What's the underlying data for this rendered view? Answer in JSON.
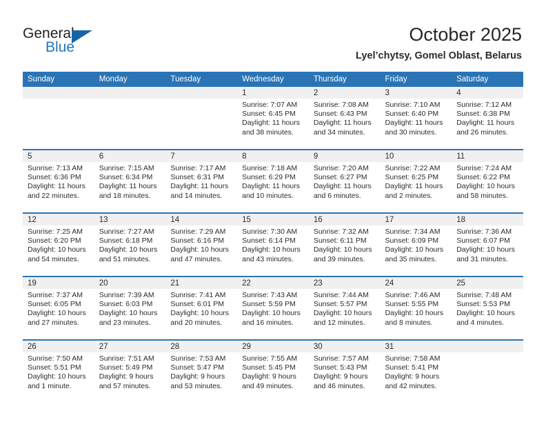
{
  "brand": {
    "name_top": "General",
    "name_bottom": "Blue",
    "accent_color": "#1e76bd",
    "triangle_color": "#1565a6"
  },
  "header": {
    "title": "October 2025",
    "subtitle": "Lyel’chytsy, Gomel Oblast, Belarus"
  },
  "theme": {
    "header_bg": "#2a74b6",
    "daynum_bg": "#f0f0f0",
    "cell_bg": "#ffffff",
    "text": "#2b2b2b"
  },
  "weekday_headers": [
    "Sunday",
    "Monday",
    "Tuesday",
    "Wednesday",
    "Thursday",
    "Friday",
    "Saturday"
  ],
  "weeks": [
    [
      {
        "day": "",
        "sunrise": "",
        "sunset": "",
        "daylight_1": "",
        "daylight_2": ""
      },
      {
        "day": "",
        "sunrise": "",
        "sunset": "",
        "daylight_1": "",
        "daylight_2": ""
      },
      {
        "day": "",
        "sunrise": "",
        "sunset": "",
        "daylight_1": "",
        "daylight_2": ""
      },
      {
        "day": "1",
        "sunrise": "Sunrise: 7:07 AM",
        "sunset": "Sunset: 6:45 PM",
        "daylight_1": "Daylight: 11 hours",
        "daylight_2": "and 38 minutes."
      },
      {
        "day": "2",
        "sunrise": "Sunrise: 7:08 AM",
        "sunset": "Sunset: 6:43 PM",
        "daylight_1": "Daylight: 11 hours",
        "daylight_2": "and 34 minutes."
      },
      {
        "day": "3",
        "sunrise": "Sunrise: 7:10 AM",
        "sunset": "Sunset: 6:40 PM",
        "daylight_1": "Daylight: 11 hours",
        "daylight_2": "and 30 minutes."
      },
      {
        "day": "4",
        "sunrise": "Sunrise: 7:12 AM",
        "sunset": "Sunset: 6:38 PM",
        "daylight_1": "Daylight: 11 hours",
        "daylight_2": "and 26 minutes."
      }
    ],
    [
      {
        "day": "5",
        "sunrise": "Sunrise: 7:13 AM",
        "sunset": "Sunset: 6:36 PM",
        "daylight_1": "Daylight: 11 hours",
        "daylight_2": "and 22 minutes."
      },
      {
        "day": "6",
        "sunrise": "Sunrise: 7:15 AM",
        "sunset": "Sunset: 6:34 PM",
        "daylight_1": "Daylight: 11 hours",
        "daylight_2": "and 18 minutes."
      },
      {
        "day": "7",
        "sunrise": "Sunrise: 7:17 AM",
        "sunset": "Sunset: 6:31 PM",
        "daylight_1": "Daylight: 11 hours",
        "daylight_2": "and 14 minutes."
      },
      {
        "day": "8",
        "sunrise": "Sunrise: 7:18 AM",
        "sunset": "Sunset: 6:29 PM",
        "daylight_1": "Daylight: 11 hours",
        "daylight_2": "and 10 minutes."
      },
      {
        "day": "9",
        "sunrise": "Sunrise: 7:20 AM",
        "sunset": "Sunset: 6:27 PM",
        "daylight_1": "Daylight: 11 hours",
        "daylight_2": "and 6 minutes."
      },
      {
        "day": "10",
        "sunrise": "Sunrise: 7:22 AM",
        "sunset": "Sunset: 6:25 PM",
        "daylight_1": "Daylight: 11 hours",
        "daylight_2": "and 2 minutes."
      },
      {
        "day": "11",
        "sunrise": "Sunrise: 7:24 AM",
        "sunset": "Sunset: 6:22 PM",
        "daylight_1": "Daylight: 10 hours",
        "daylight_2": "and 58 minutes."
      }
    ],
    [
      {
        "day": "12",
        "sunrise": "Sunrise: 7:25 AM",
        "sunset": "Sunset: 6:20 PM",
        "daylight_1": "Daylight: 10 hours",
        "daylight_2": "and 54 minutes."
      },
      {
        "day": "13",
        "sunrise": "Sunrise: 7:27 AM",
        "sunset": "Sunset: 6:18 PM",
        "daylight_1": "Daylight: 10 hours",
        "daylight_2": "and 51 minutes."
      },
      {
        "day": "14",
        "sunrise": "Sunrise: 7:29 AM",
        "sunset": "Sunset: 6:16 PM",
        "daylight_1": "Daylight: 10 hours",
        "daylight_2": "and 47 minutes."
      },
      {
        "day": "15",
        "sunrise": "Sunrise: 7:30 AM",
        "sunset": "Sunset: 6:14 PM",
        "daylight_1": "Daylight: 10 hours",
        "daylight_2": "and 43 minutes."
      },
      {
        "day": "16",
        "sunrise": "Sunrise: 7:32 AM",
        "sunset": "Sunset: 6:11 PM",
        "daylight_1": "Daylight: 10 hours",
        "daylight_2": "and 39 minutes."
      },
      {
        "day": "17",
        "sunrise": "Sunrise: 7:34 AM",
        "sunset": "Sunset: 6:09 PM",
        "daylight_1": "Daylight: 10 hours",
        "daylight_2": "and 35 minutes."
      },
      {
        "day": "18",
        "sunrise": "Sunrise: 7:36 AM",
        "sunset": "Sunset: 6:07 PM",
        "daylight_1": "Daylight: 10 hours",
        "daylight_2": "and 31 minutes."
      }
    ],
    [
      {
        "day": "19",
        "sunrise": "Sunrise: 7:37 AM",
        "sunset": "Sunset: 6:05 PM",
        "daylight_1": "Daylight: 10 hours",
        "daylight_2": "and 27 minutes."
      },
      {
        "day": "20",
        "sunrise": "Sunrise: 7:39 AM",
        "sunset": "Sunset: 6:03 PM",
        "daylight_1": "Daylight: 10 hours",
        "daylight_2": "and 23 minutes."
      },
      {
        "day": "21",
        "sunrise": "Sunrise: 7:41 AM",
        "sunset": "Sunset: 6:01 PM",
        "daylight_1": "Daylight: 10 hours",
        "daylight_2": "and 20 minutes."
      },
      {
        "day": "22",
        "sunrise": "Sunrise: 7:43 AM",
        "sunset": "Sunset: 5:59 PM",
        "daylight_1": "Daylight: 10 hours",
        "daylight_2": "and 16 minutes."
      },
      {
        "day": "23",
        "sunrise": "Sunrise: 7:44 AM",
        "sunset": "Sunset: 5:57 PM",
        "daylight_1": "Daylight: 10 hours",
        "daylight_2": "and 12 minutes."
      },
      {
        "day": "24",
        "sunrise": "Sunrise: 7:46 AM",
        "sunset": "Sunset: 5:55 PM",
        "daylight_1": "Daylight: 10 hours",
        "daylight_2": "and 8 minutes."
      },
      {
        "day": "25",
        "sunrise": "Sunrise: 7:48 AM",
        "sunset": "Sunset: 5:53 PM",
        "daylight_1": "Daylight: 10 hours",
        "daylight_2": "and 4 minutes."
      }
    ],
    [
      {
        "day": "26",
        "sunrise": "Sunrise: 7:50 AM",
        "sunset": "Sunset: 5:51 PM",
        "daylight_1": "Daylight: 10 hours",
        "daylight_2": "and 1 minute."
      },
      {
        "day": "27",
        "sunrise": "Sunrise: 7:51 AM",
        "sunset": "Sunset: 5:49 PM",
        "daylight_1": "Daylight: 9 hours",
        "daylight_2": "and 57 minutes."
      },
      {
        "day": "28",
        "sunrise": "Sunrise: 7:53 AM",
        "sunset": "Sunset: 5:47 PM",
        "daylight_1": "Daylight: 9 hours",
        "daylight_2": "and 53 minutes."
      },
      {
        "day": "29",
        "sunrise": "Sunrise: 7:55 AM",
        "sunset": "Sunset: 5:45 PM",
        "daylight_1": "Daylight: 9 hours",
        "daylight_2": "and 49 minutes."
      },
      {
        "day": "30",
        "sunrise": "Sunrise: 7:57 AM",
        "sunset": "Sunset: 5:43 PM",
        "daylight_1": "Daylight: 9 hours",
        "daylight_2": "and 46 minutes."
      },
      {
        "day": "31",
        "sunrise": "Sunrise: 7:58 AM",
        "sunset": "Sunset: 5:41 PM",
        "daylight_1": "Daylight: 9 hours",
        "daylight_2": "and 42 minutes."
      },
      {
        "day": "",
        "sunrise": "",
        "sunset": "",
        "daylight_1": "",
        "daylight_2": ""
      }
    ]
  ]
}
